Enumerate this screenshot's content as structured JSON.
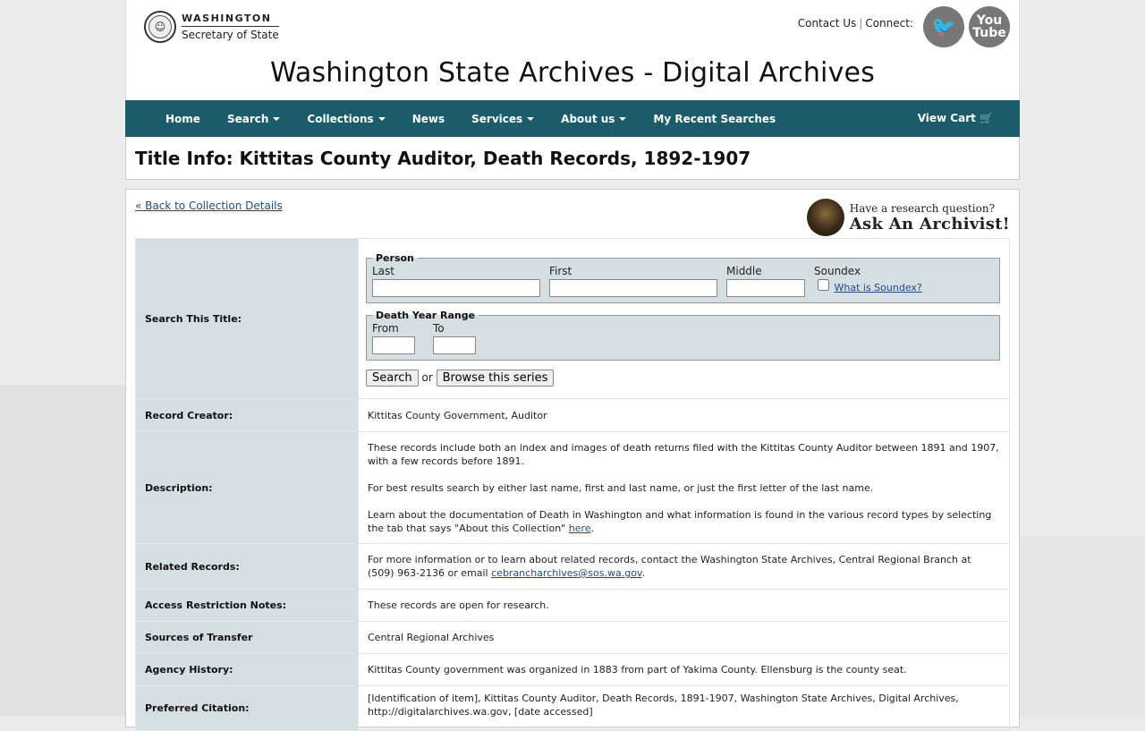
{
  "header": {
    "logo_line1": "WASHINGTON",
    "logo_line2": "Secretary of State",
    "contact_us": "Contact Us",
    "connect": "Connect:",
    "youtube_line1": "You",
    "youtube_line2": "Tube",
    "site_title": "Washington State Archives - Digital Archives"
  },
  "nav": {
    "items": [
      {
        "label": "Home",
        "dropdown": false
      },
      {
        "label": "Search",
        "dropdown": true
      },
      {
        "label": "Collections",
        "dropdown": true
      },
      {
        "label": "News",
        "dropdown": false
      },
      {
        "label": "Services",
        "dropdown": true
      },
      {
        "label": "About us",
        "dropdown": true
      },
      {
        "label": "My Recent Searches",
        "dropdown": false
      }
    ],
    "cart_label": "View Cart",
    "cart_icon": "🛒"
  },
  "page": {
    "title": "Title Info: Kittitas County Auditor, Death Records, 1892-1907",
    "back_link": "« Back to Collection Details",
    "ask_line1": "Have a research question?",
    "ask_line2": "Ask An Archivist!"
  },
  "search": {
    "row_label": "Search This Title:",
    "person_legend": "Person",
    "last_label": "Last",
    "first_label": "First",
    "middle_label": "Middle",
    "soundex_label": "Soundex",
    "soundex_link": "What is Soundex?",
    "last_value": "",
    "first_value": "",
    "middle_value": "",
    "year_legend": "Death Year Range",
    "from_label": "From",
    "to_label": "To",
    "from_value": "",
    "to_value": "",
    "search_button": "Search",
    "or_text": "or",
    "browse_button": "Browse this series"
  },
  "details": {
    "record_creator_label": "Record Creator:",
    "record_creator": "Kittitas County Government, Auditor",
    "description_label": "Description:",
    "description_p1": "These records include both an index and images of death returns filed with the Kittitas County Auditor between 1891 and 1907, with a few records before 1891.",
    "description_p2": "For best results search by either last name, first and last name, or just the first letter of the last name.",
    "description_p3_pre": "Learn about the documentation of Death in Washington and what information is found in the various record types by selecting the tab that says \"About this Collection\" ",
    "description_p3_link": "here",
    "description_p3_post": ".",
    "related_label": "Related Records:",
    "related_pre": "For more information or to learn about related records, contact the Washington State Archives, Central Regional Branch at (509) 963-2136 or email ",
    "related_email": "cebrancharchives@sos.wa.gov",
    "related_post": ".",
    "access_label": "Access Restriction Notes:",
    "access": "These records are open for research.",
    "sources_label": "Sources of Transfer",
    "sources": "Central Regional Archives",
    "agency_label": "Agency History:",
    "agency": "Kittitas County government was organized in 1883 from part of Yakima County. Ellensburg is the county seat.",
    "citation_label": "Preferred Citation:",
    "citation": "[Identification of item], Kittitas County Auditor, Death Records, 1891-1907, Washington State Archives, Digital Archives, http://digitalarchives.wa.gov, [date accessed]"
  },
  "colors": {
    "nav_bg": "#1b5c6a",
    "label_bg": "#d5dfe2",
    "link": "#1a4c8b"
  }
}
